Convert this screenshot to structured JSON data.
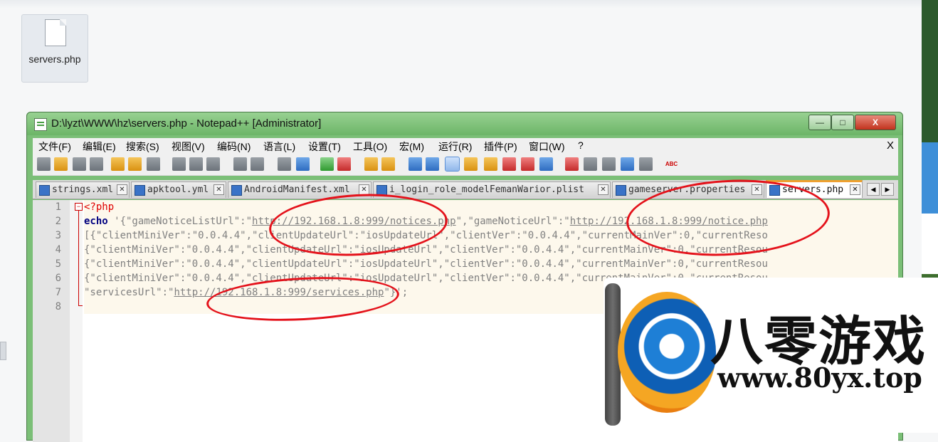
{
  "desktop": {
    "file_icon_label": "servers.php"
  },
  "window": {
    "title": "D:\\lyzt\\WWW\\hz\\servers.php - Notepad++ [Administrator]",
    "minimize_symbol": "—",
    "maximize_symbol": "□",
    "close_symbol": "X"
  },
  "menu": {
    "items": [
      "文件(F)",
      "编辑(E)",
      "搜索(S)",
      "视图(V)",
      "编码(N)",
      "语言(L)",
      "设置(T)",
      "工具(O)",
      "宏(M)",
      "运行(R)",
      "插件(P)",
      "窗口(W)",
      "?"
    ],
    "close_label": "X"
  },
  "toolbar": {
    "icons": [
      "new-file-icon",
      "open-file-icon",
      "save-icon",
      "save-all-icon",
      "close-icon",
      "close-all-icon",
      "print-icon",
      "cut-icon",
      "copy-icon",
      "paste-icon",
      "undo-icon",
      "redo-icon",
      "find-icon",
      "replace-icon",
      "zoom-in-icon",
      "zoom-out-icon",
      "sync-vertical-icon",
      "sync-horizontal-icon",
      "word-wrap-icon",
      "show-all-chars-icon",
      "indent-guide-icon",
      "user-language-icon",
      "doc-map-icon",
      "function-list-icon",
      "folder-workspace-icon",
      "monitor-icon",
      "record-macro-icon",
      "stop-macro-icon",
      "play-macro-icon",
      "run-macro-multiple-icon",
      "save-macro-icon",
      "spell-check-icon"
    ],
    "spell_check_text": "ABC"
  },
  "tabs": [
    {
      "label": "strings.xml",
      "active": false
    },
    {
      "label": "apktool.yml",
      "active": false
    },
    {
      "label": "AndroidManifest.xml",
      "active": false
    },
    {
      "label": "i_login_role_modelFemanWarior.plist",
      "active": false
    },
    {
      "label": "gameserver.properties",
      "active": false
    },
    {
      "label": "servers.php",
      "active": true
    }
  ],
  "editor": {
    "line_numbers": [
      "1",
      "2",
      "3",
      "4",
      "5",
      "6",
      "7",
      "8"
    ],
    "lines": {
      "l1": "<?php",
      "l2_kw": "echo",
      "l2_a": " '{\"gameNoticeListUrl\":\"",
      "l2_url1": "http://192.168.1.8:999/notices.php",
      "l2_b": "\",\"gameNoticeUrl\":\"",
      "l2_url2": "http://192.168.1.8:999/notice.php",
      "l3": "[{\"clientMiniVer\":\"0.0.4.4\",\"clientUpdateUrl\":\"iosUpdateUrl\",\"clientVer\":\"0.0.4.4\",\"currentMainVer\":0,\"currentReso",
      "l4": "{\"clientMiniVer\":\"0.0.4.4\",\"clientUpdateUrl\":\"iosUpdateUrl\",\"clientVer\":\"0.0.4.4\",\"currentMainVer\":0,\"currentResou",
      "l5": "{\"clientMiniVer\":\"0.0.4.4\",\"clientUpdateUrl\":\"iosUpdateUrl\",\"clientVer\":\"0.0.4.4\",\"currentMainVer\":0,\"currentResou",
      "l6": "{\"clientMiniVer\":\"0.0.4.4\",\"clientUpdateUrl\":\"iosUpdateUrl\",\"clientVer\":\"0.0.4.4\",\"currentMainVer\":0,\"currentResou",
      "l7_a": "\"servicesUrl\":\"",
      "l7_url": "http://192.168.1.8:999/services.php",
      "l7_b": "\"}';"
    }
  },
  "watermark": {
    "title": "八零游戏",
    "url": "www.80yx.top"
  },
  "colors": {
    "titlebar": "#7bbf77",
    "annotation": "#e4121b",
    "php_tag": "#e00000",
    "keyword": "#000080",
    "active_tab_accent": "#f0a030"
  }
}
